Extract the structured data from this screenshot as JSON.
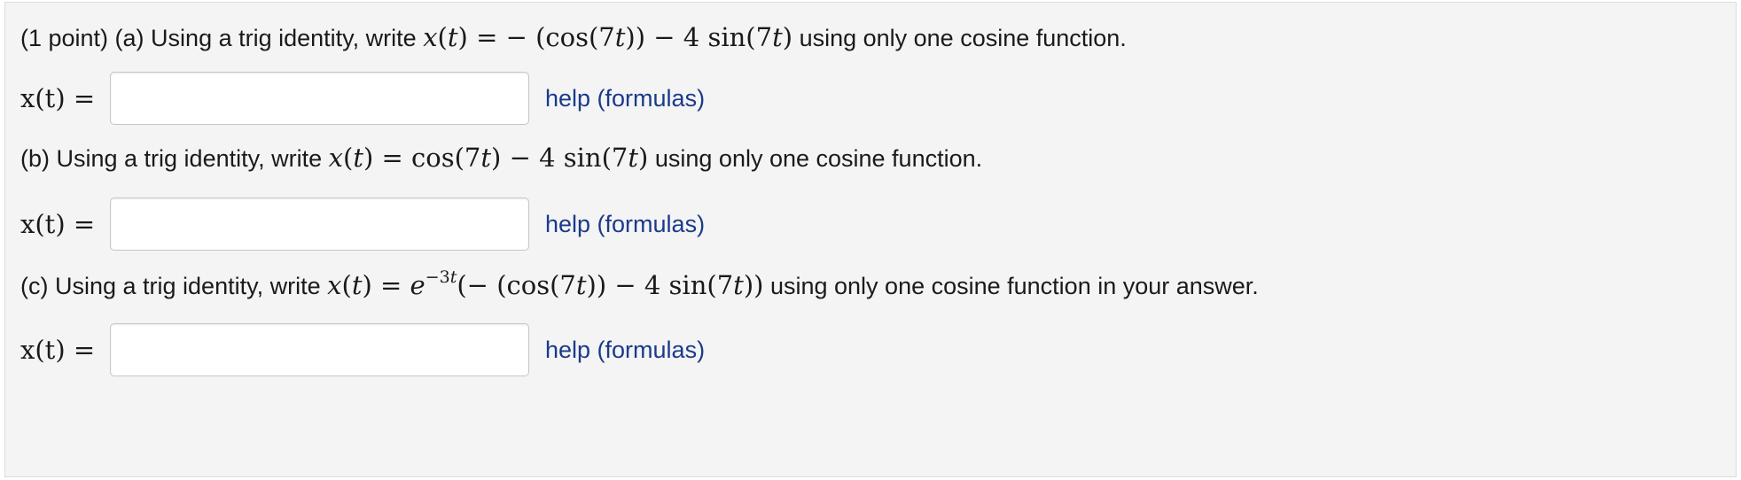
{
  "parts": [
    {
      "prefix": "(1 point) (a) Using a trig identity, write",
      "expression": "x(t) = − (cos(7t)) − 4 sin(7t)",
      "suffix": "using only one cosine function."
    },
    {
      "prefix": "(b) Using a trig identity, write",
      "expression": "x(t) = cos(7t) − 4 sin(7t)",
      "suffix": "using only one cosine function."
    },
    {
      "prefix": "(c) Using a trig identity, write",
      "expression": "x(t) = e−3t(− (cos(7t)) − 4 sin(7t))",
      "suffix": "using only one cosine function in your answer."
    }
  ],
  "answer_label": "x(t) =",
  "answer_value": "",
  "help_link_label": "help (formulas)"
}
